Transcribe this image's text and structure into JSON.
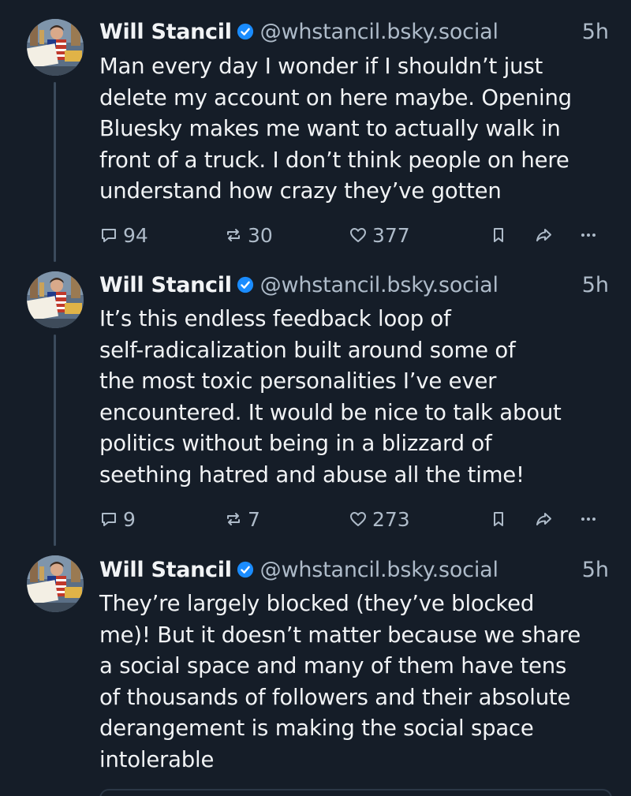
{
  "posts": [
    {
      "author": {
        "name": "Will Stancil",
        "handle": "@whstancil.bsky.social",
        "avatar_sign": "There are more of us than them"
      },
      "time": "5h",
      "text": "Man every day I wonder if I shouldn’t just\ndelete my account on here maybe. Opening\nBluesky makes me want to actually walk in\nfront of a truck. I don’t think people on here\nunderstand how crazy they’ve gotten",
      "stats": {
        "replies": "94",
        "reposts": "30",
        "likes": "377"
      }
    },
    {
      "author": {
        "name": "Will Stancil",
        "handle": "@whstancil.bsky.social",
        "avatar_sign": "There are more of us than them"
      },
      "time": "5h",
      "text": "It’s this endless feedback loop of\nself-radicalization built around some of\nthe most toxic personalities I’ve ever\nencountered. It would be nice to talk about\npolitics without being in a blizzard of\nseething hatred and abuse all the time!",
      "stats": {
        "replies": "9",
        "reposts": "7",
        "likes": "273"
      }
    },
    {
      "author": {
        "name": "Will Stancil",
        "handle": "@whstancil.bsky.social",
        "avatar_sign": "There are more of us than them"
      },
      "time": "5h",
      "text": "They’re largely blocked (they’ve blocked\nme)! But it doesn’t matter because we share\na social space and many of them have tens\nof thousands of followers and their absolute\nderangement is making the social space\nintolerable"
    }
  ],
  "icons": {
    "verified": "verified-badge-icon",
    "reply": "reply-icon",
    "repost": "repost-icon",
    "like": "heart-icon",
    "bookmark": "bookmark-icon",
    "share": "share-icon",
    "more": "more-icon"
  },
  "colors": {
    "background": "#151d28",
    "text": "#f1f3f5",
    "muted": "#aebbc9",
    "verified": "#1a8cff",
    "thread_line": "#3b4a5c"
  }
}
